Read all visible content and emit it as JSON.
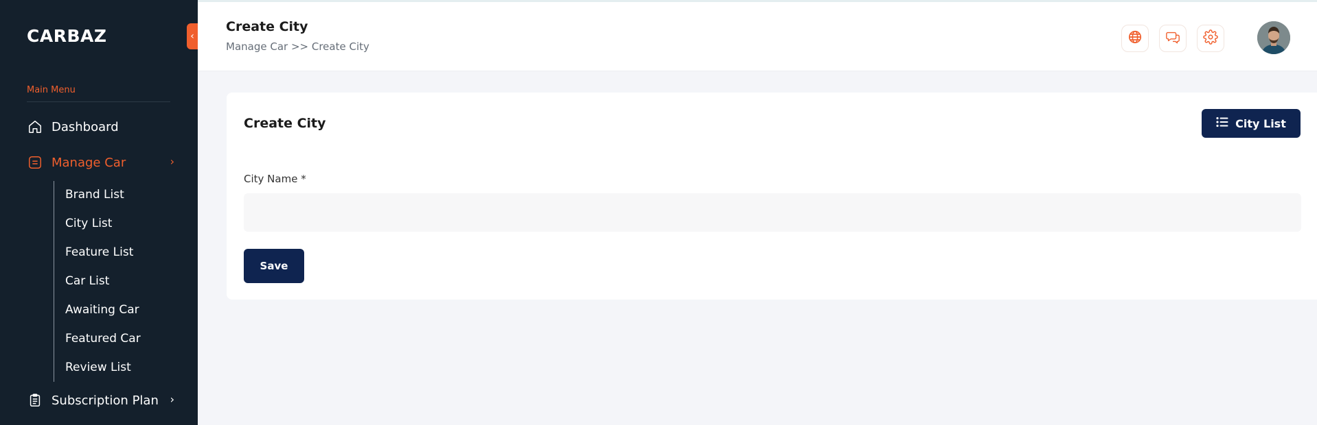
{
  "brand": "CARBAZ",
  "sidebar": {
    "menu_label": "Main Menu",
    "items": [
      {
        "label": "Dashboard",
        "icon": "home-icon"
      },
      {
        "label": "Manage Car",
        "icon": "list-square-icon",
        "active": true,
        "chevron": "›"
      },
      {
        "label": "Subscription Plan",
        "icon": "clipboard-icon",
        "chevron": "›"
      }
    ],
    "submenu": [
      "Brand List",
      "City List",
      "Feature List",
      "Car List",
      "Awaiting Car",
      "Featured Car",
      "Review List"
    ],
    "collapse_glyph": "‹"
  },
  "topbar": {
    "title": "Create City",
    "breadcrumb": "Manage Car >> Create City",
    "icons": [
      "globe-icon",
      "chat-icon",
      "gear-icon"
    ]
  },
  "card": {
    "title": "Create City",
    "city_list_button": "City List",
    "field_label": "City Name *",
    "field_value": "",
    "field_placeholder": "",
    "save_button": "Save"
  },
  "colors": {
    "sidebar_bg": "#14202c",
    "accent": "#f05f2d",
    "primary_button": "#0f2450",
    "page_bg": "#f4f5f9"
  }
}
